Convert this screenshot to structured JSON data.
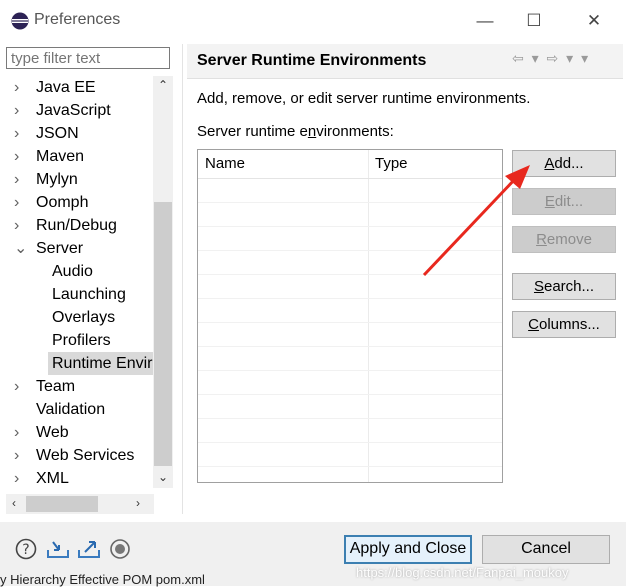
{
  "window": {
    "title": "Preferences",
    "minimize_glyph": "—",
    "maximize_glyph": "☐",
    "close_glyph": "✕"
  },
  "filter": {
    "placeholder": "type filter text"
  },
  "tree": {
    "items": [
      {
        "label": "Java EE",
        "expander": "›"
      },
      {
        "label": "JavaScript",
        "expander": "›"
      },
      {
        "label": "JSON",
        "expander": "›"
      },
      {
        "label": "Maven",
        "expander": "›"
      },
      {
        "label": "Mylyn",
        "expander": "›"
      },
      {
        "label": "Oomph",
        "expander": "›"
      },
      {
        "label": "Run/Debug",
        "expander": "›"
      },
      {
        "label": "Server",
        "expander": "⌄"
      },
      {
        "label": "Audio"
      },
      {
        "label": "Launching"
      },
      {
        "label": "Overlays"
      },
      {
        "label": "Profilers"
      },
      {
        "label": "Runtime Envir"
      },
      {
        "label": "Team",
        "expander": "›"
      },
      {
        "label": "Validation"
      },
      {
        "label": "Web",
        "expander": "›"
      },
      {
        "label": "Web Services",
        "expander": "›"
      },
      {
        "label": "XML",
        "expander": "›"
      }
    ]
  },
  "scroll": {
    "up": "⌃",
    "down": "⌄",
    "left": "‹",
    "right": "›"
  },
  "panel": {
    "title": "Server Runtime Environments",
    "description": "Add, remove, or edit server runtime environments.",
    "list_label_pre": "Server runtime e",
    "list_label_mnemonic": "n",
    "list_label_post": "vironments:",
    "nav": "⇦ ▾ ⇨ ▾ ▾"
  },
  "table": {
    "columns": [
      "Name",
      "Type"
    ]
  },
  "buttons": {
    "add": {
      "pre": "",
      "mn": "A",
      "post": "dd..."
    },
    "edit": {
      "pre": "",
      "mn": "E",
      "post": "dit..."
    },
    "remove": {
      "pre": "",
      "mn": "R",
      "post": "emove"
    },
    "search": {
      "pre": "",
      "mn": "S",
      "post": "earch..."
    },
    "columns": {
      "pre": "",
      "mn": "C",
      "post": "olumns..."
    }
  },
  "footer": {
    "apply_close": "Apply and Close",
    "cancel": "Cancel"
  },
  "overlay": {
    "watermark": "https://blog.csdn.net/Fanpai_moukoy",
    "background_text": "y Hierarchy  Effective POM  pom.xml"
  },
  "colors": {
    "annotation_arrow": "#e8281e",
    "selection": "#d9d9d9",
    "default_button_border": "#3c7fb1"
  }
}
